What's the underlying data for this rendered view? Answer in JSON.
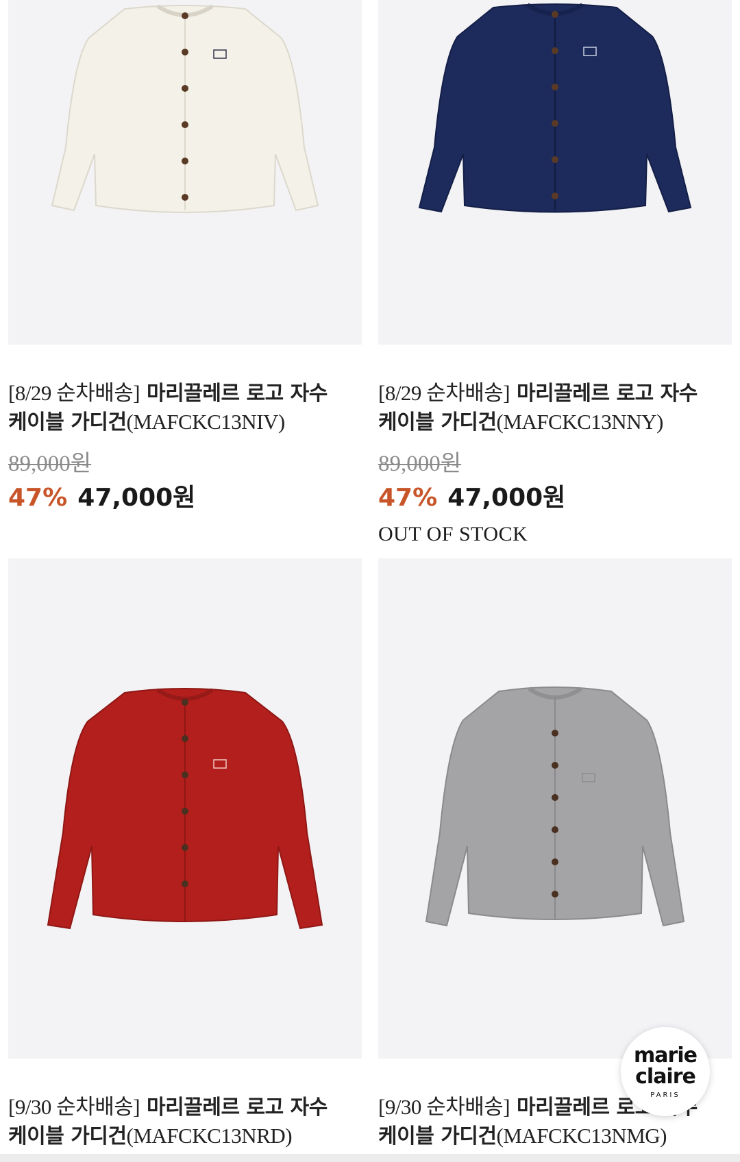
{
  "products": [
    {
      "title_prefix": "[8/29 순차배송]",
      "title_main": " 마리끌레르 로고 자수",
      "title_line2": "케이블 가디건",
      "code": "(MAFCKC13NIV)",
      "original_price": "89,000원",
      "discount": "47%",
      "sale_price": "47,000원",
      "stock_status": "",
      "garment_color": "#f4f1e8"
    },
    {
      "title_prefix": "[8/29 순차배송]",
      "title_main": " 마리끌레르 로고 자수",
      "title_line2": "케이블 가디건",
      "code": "(MAFCKC13NNY)",
      "original_price": "89,000원",
      "discount": "47%",
      "sale_price": "47,000원",
      "stock_status": "OUT OF STOCK",
      "garment_color": "#1c2a5c"
    },
    {
      "title_prefix": "[9/30 순차배송]",
      "title_main": " 마리끌레르 로고 자수",
      "title_line2": "케이블 가디건",
      "code": "(MAFCKC13NRD)",
      "garment_color": "#b31f1c"
    },
    {
      "title_prefix": "[9/30 순차배송]",
      "title_main": " 마리끌레르 로고 자수",
      "title_line2": "케이블 가디건",
      "code": "(MAFCKC13NMG)",
      "garment_color": "#a4a4a6"
    }
  ],
  "logo": {
    "line1": "marie",
    "line2": "claire",
    "line3": "PARIS"
  },
  "colors": {
    "accent_discount": "#c8552a",
    "image_bg": "#f3f3f6"
  }
}
